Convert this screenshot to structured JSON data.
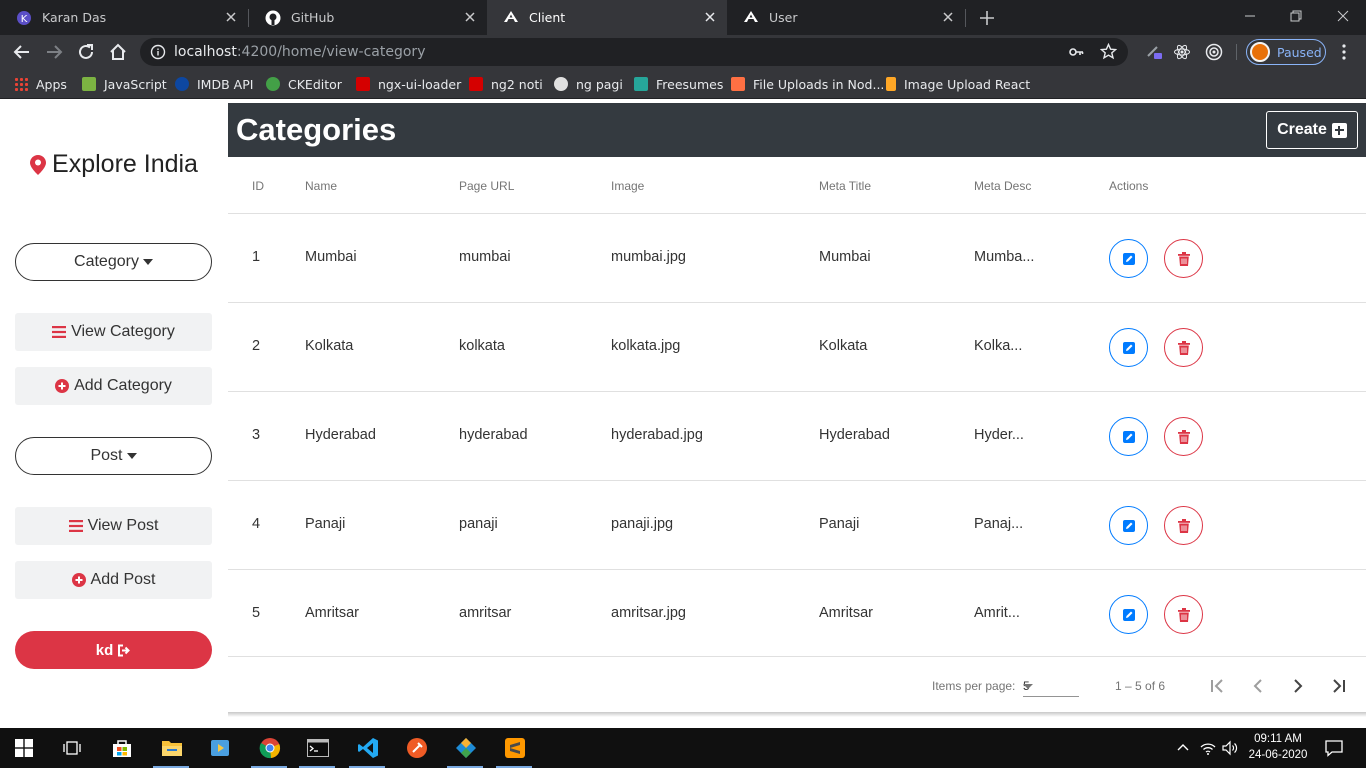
{
  "browser": {
    "tabs": [
      {
        "title": "Karan Das",
        "icon": "karan-das-favicon",
        "active": false
      },
      {
        "title": "GitHub",
        "icon": "github-favicon",
        "active": false
      },
      {
        "title": "Client",
        "icon": "angular-favicon",
        "active": true
      },
      {
        "title": "User",
        "icon": "angular-favicon",
        "active": false
      }
    ],
    "url_host": "localhost",
    "url_path": ":4200/home/view-category",
    "profile_status": "Paused",
    "bookmarks": [
      {
        "label": "Apps",
        "color": "#f4b400"
      },
      {
        "label": "JavaScript",
        "color": "#7cb342"
      },
      {
        "label": "IMDB API",
        "color": "#0d47a1"
      },
      {
        "label": "CKEditor",
        "color": "#43a047"
      },
      {
        "label": "ngx-ui-loader",
        "color": "#d50000"
      },
      {
        "label": "ng2 noti",
        "color": "#d50000"
      },
      {
        "label": "ng pagi",
        "color": "#e0e0e0"
      },
      {
        "label": "Freesumes",
        "color": "#26a69a"
      },
      {
        "label": "File Uploads in Nod...",
        "color": "#ff7043"
      },
      {
        "label": "Image Upload React",
        "color": "#ffa726"
      }
    ]
  },
  "sidebar": {
    "brand": "Explore India",
    "category_toggle": "Category",
    "view_category": "View Category",
    "add_category": "Add Category",
    "post_toggle": "Post",
    "view_post": "View Post",
    "add_post": "Add Post",
    "user_button": "kd"
  },
  "main": {
    "title": "Categories",
    "create_label": "Create",
    "columns": [
      "ID",
      "Name",
      "Page URL",
      "Image",
      "Meta Title",
      "Meta Desc",
      "Actions"
    ],
    "rows": [
      {
        "id": "1",
        "name": "Mumbai",
        "page_url": "mumbai",
        "image": "mumbai.jpg",
        "meta_title": "Mumbai",
        "meta_desc": "Mumba..."
      },
      {
        "id": "2",
        "name": "Kolkata",
        "page_url": "kolkata",
        "image": "kolkata.jpg",
        "meta_title": "Kolkata",
        "meta_desc": "Kolka..."
      },
      {
        "id": "3",
        "name": "Hyderabad",
        "page_url": "hyderabad",
        "image": "hyderabad.jpg",
        "meta_title": "Hyderabad",
        "meta_desc": "Hyder..."
      },
      {
        "id": "4",
        "name": "Panaji",
        "page_url": "panaji",
        "image": "panaji.jpg",
        "meta_title": "Panaji",
        "meta_desc": "Panaj..."
      },
      {
        "id": "5",
        "name": "Amritsar",
        "page_url": "amritsar",
        "image": "amritsar.jpg",
        "meta_title": "Amritsar",
        "meta_desc": "Amrit..."
      }
    ],
    "paginator": {
      "items_per_page_label": "Items per page:",
      "items_per_page_value": "5",
      "range_label": "1 – 5 of 6"
    }
  },
  "taskbar": {
    "time": "09:11 AM",
    "date": "24-06-2020"
  },
  "colors": {
    "header_bg": "#343a40",
    "danger": "#dc3545",
    "primary": "#007bff"
  }
}
